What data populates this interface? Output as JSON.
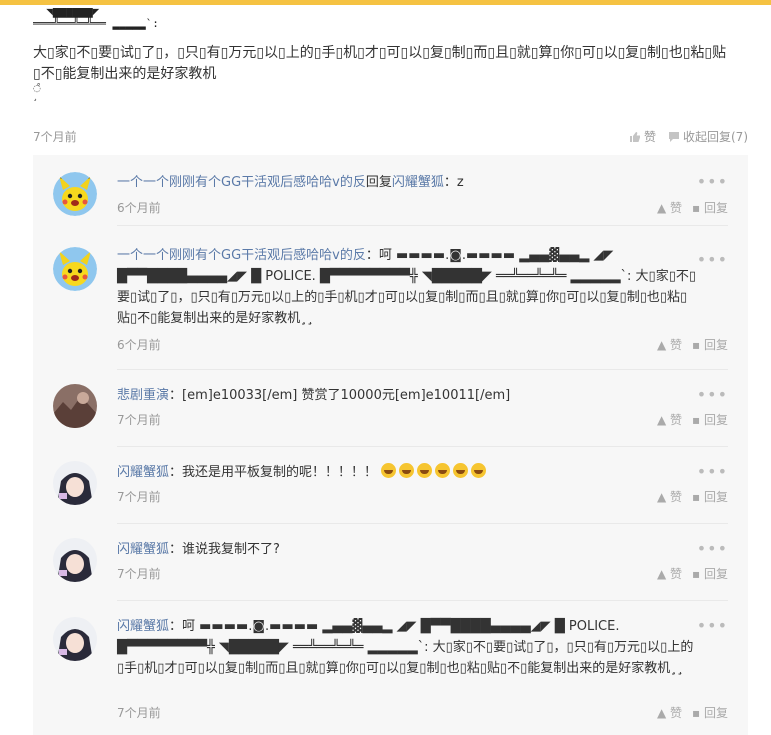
{
  "main_comment": {
    "art_line1": "  ◥▆▆▆▆▆▆◤",
    "art_line2": "═══╩══╩═╩══ ▂▂▂▂▂`:",
    "text": "大\u0000家\u0000不\u0000要\u0000试\u0000了\u0000，\u0000只\u0000有\u0000万元\u0000以\u0000上的\u0000手\u0000机\u0000才\u0000可\u0000以\u0000复\u0000制\u0000而\u0000且\u0000就\u0000算\u0000你\u0000可\u0000以\u0000复\u0000制\u0000也\u0000粘\u0000贴\u0000不\u0000能复制出来的是好家教机",
    "tail1": "◌̊",
    "tail2": "¸̧",
    "time": "7个月前",
    "like_label": "赞",
    "collapse_label": "收起回复(7)"
  },
  "replies": [
    {
      "username": "一个一个刚刚有个GG干活观后感哈哈v的反",
      "prefix": "回复",
      "target": "闪耀蟹狐",
      "content": "：z",
      "time": "6个月前",
      "like_label": "赞",
      "reply_label": "回复",
      "avatar": "pikachu-avatar"
    },
    {
      "username": "一个一个刚刚有个GG干活观后感哈哈v的反",
      "prefix": "",
      "target": "",
      "content": "：呵 ▬▬▬▬.◙.▬▬▬▬ ▂▄▄▓▄▄▂ ◢◤ █▀▀████▄▄▄▄◢◤ █ POLICE. █▀▀▀▀▀▀▀▀╬ ◥█████◤ ══╩══╩═╩═ ▂▂▂▂▂`: 大\u0000家\u0000不\u0000要\u0000试\u0000了\u0000，\u0000只\u0000有\u0000万元\u0000以\u0000上的\u0000手\u0000机\u0000才\u0000可\u0000以\u0000复\u0000制\u0000而\u0000且\u0000就\u0000算\u0000你\u0000可\u0000以\u0000复\u0000制\u0000也\u0000粘\u0000贴\u0000不\u0000能复制出来的是好家教机¸̧¸̧",
      "time": "6个月前",
      "like_label": "赞",
      "reply_label": "回复",
      "avatar": "pikachu-avatar"
    },
    {
      "username": "悲剧重演",
      "prefix": "",
      "target": "",
      "content": "：[em]e10033[/em] 赞赏了10000元[em]e10011[/em]",
      "time": "7个月前",
      "like_label": "赞",
      "reply_label": "回复",
      "avatar": "photo-avatar"
    },
    {
      "username": "闪耀蟹狐",
      "prefix": "",
      "target": "",
      "content": "：我还是用平板复制的呢！！！！！",
      "emoji_count": 6,
      "time": "7个月前",
      "like_label": "赞",
      "reply_label": "回复",
      "avatar": "anime-avatar"
    },
    {
      "username": "闪耀蟹狐",
      "prefix": "",
      "target": "",
      "content": "：谁说我复制不了?",
      "time": "7个月前",
      "like_label": "赞",
      "reply_label": "回复",
      "avatar": "anime-avatar"
    },
    {
      "username": "闪耀蟹狐",
      "prefix": "",
      "target": "",
      "content": "：呵 ▬▬▬▬.◙.▬▬▬▬ ▂▄▄▓▄▄▂ ◢◤ █▀▀████▄▄▄▄◢◤ █ POLICE. █▀▀▀▀▀▀▀▀╬ ◥█████◤ ══╩══╩═╩═ ▂▂▂▂▂`: 大\u0000家\u0000不\u0000要\u0000试\u0000了\u0000，\u0000只\u0000有\u0000万元\u0000以\u0000上的\u0000手\u0000机\u0000才\u0000可\u0000以\u0000复\u0000制\u0000而\u0000且\u0000就\u0000算\u0000你\u0000可\u0000以\u0000复\u0000制\u0000也\u0000粘\u0000贴\u0000不\u0000能复制出来的是好家教机¸̧¸̧",
      "time": "7个月前",
      "like_label": "赞",
      "reply_label": "回复",
      "avatar": "anime-avatar"
    }
  ],
  "more_label": "•••",
  "colors": {
    "accent": "#f5c242",
    "username": "#5b7aa8",
    "muted": "#999999"
  }
}
